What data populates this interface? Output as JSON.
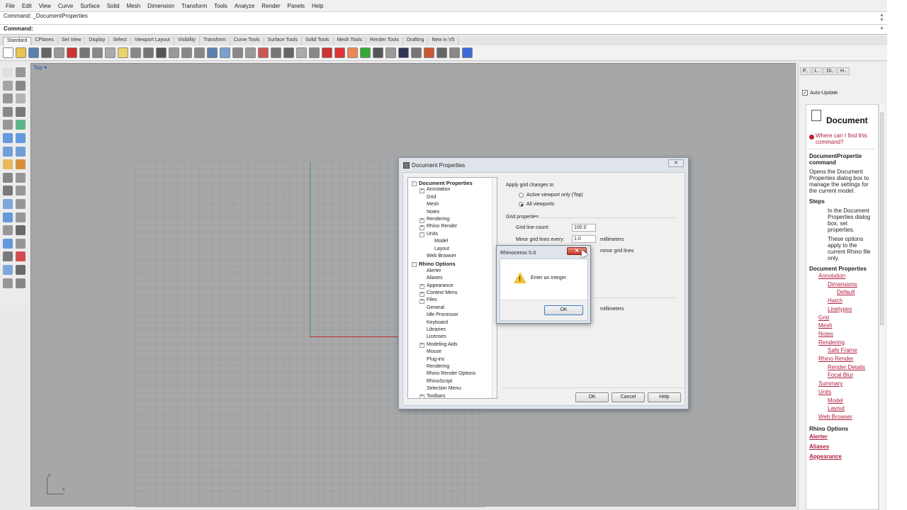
{
  "menu": [
    "File",
    "Edit",
    "View",
    "Curve",
    "Surface",
    "Solid",
    "Mesh",
    "Dimension",
    "Transform",
    "Tools",
    "Analyze",
    "Render",
    "Panels",
    "Help"
  ],
  "command": {
    "history": "Command: _DocumentProperties",
    "prompt": "Command:"
  },
  "toolbar_tabs": [
    "Standard",
    "CPlanes",
    "Set View",
    "Display",
    "Select",
    "Viewport Layout",
    "Visibility",
    "Transform",
    "Curve Tools",
    "Surface Tools",
    "Solid Tools",
    "Mesh Tools",
    "Render Tools",
    "Drafting",
    "New in V5"
  ],
  "viewport": {
    "label": "Top",
    "axis_x": "x",
    "axis_y": "y"
  },
  "right_panel": {
    "tabs": [
      "P..",
      "L..",
      "Di..",
      "H.."
    ],
    "auto_update": "Auto-Update",
    "help": {
      "title": "Document",
      "where_link": "Where can I find this command?",
      "command_name": "DocumentPropertie command",
      "description": "Opens the Document Properties dialog box to manage the settings for the current model.",
      "steps_heading": "Steps",
      "step1": "In the Document Properties dialog box, set properties.",
      "step2": "These options apply to the current Rhino file only.",
      "doc_props_heading": "Document Properties",
      "links": [
        {
          "text": "Annotation",
          "indent": 1
        },
        {
          "text": "Dimensions",
          "indent": 2
        },
        {
          "text": "Default",
          "indent": 3
        },
        {
          "text": "Hatch",
          "indent": 2
        },
        {
          "text": "Linetypes",
          "indent": 2
        },
        {
          "text": "Grid",
          "indent": 1
        },
        {
          "text": "Mesh",
          "indent": 1
        },
        {
          "text": "Notes",
          "indent": 1
        },
        {
          "text": "Rendering",
          "indent": 1
        },
        {
          "text": "Safe Frame",
          "indent": 2
        },
        {
          "text": "Rhino Render",
          "indent": 1
        },
        {
          "text": "Render Details",
          "indent": 2
        },
        {
          "text": "Focal Blur",
          "indent": 2
        },
        {
          "text": "Summary",
          "indent": 1
        },
        {
          "text": "Units",
          "indent": 1
        },
        {
          "text": "Model",
          "indent": 2
        },
        {
          "text": "Layout",
          "indent": 2
        },
        {
          "text": "Web Browser",
          "indent": 1
        }
      ],
      "rhino_options_heading": "Rhino Options",
      "options_links": [
        "Alerter",
        "Aliases",
        "Appearance"
      ]
    }
  },
  "doc_dialog": {
    "title": "Document Properties",
    "close": "✕",
    "tree": [
      {
        "text": "Document Properties",
        "level": 0,
        "bold": true,
        "exp": "-"
      },
      {
        "text": "Annotation",
        "level": 1,
        "exp": "+"
      },
      {
        "text": "Grid",
        "level": 1
      },
      {
        "text": "Mesh",
        "level": 1
      },
      {
        "text": "Notes",
        "level": 1
      },
      {
        "text": "Rendering",
        "level": 1,
        "exp": "+"
      },
      {
        "text": "Rhino Render",
        "level": 1,
        "exp": "+"
      },
      {
        "text": "Units",
        "level": 1,
        "exp": "-"
      },
      {
        "text": "Model",
        "level": 2
      },
      {
        "text": "Layout",
        "level": 2
      },
      {
        "text": "Web Browser",
        "level": 1
      },
      {
        "text": "Rhino Options",
        "level": 0,
        "bold": true,
        "exp": "-"
      },
      {
        "text": "Alerter",
        "level": 1
      },
      {
        "text": "Aliases",
        "level": 1
      },
      {
        "text": "Appearance",
        "level": 1,
        "exp": "+"
      },
      {
        "text": "Context Menu",
        "level": 1,
        "exp": "+"
      },
      {
        "text": "Files",
        "level": 1,
        "exp": "+"
      },
      {
        "text": "General",
        "level": 1
      },
      {
        "text": "Idle Processor",
        "level": 1
      },
      {
        "text": "Keyboard",
        "level": 1
      },
      {
        "text": "Libraries",
        "level": 1
      },
      {
        "text": "Licenses",
        "level": 1
      },
      {
        "text": "Modeling Aids",
        "level": 1,
        "exp": "+"
      },
      {
        "text": "Mouse",
        "level": 1
      },
      {
        "text": "Plug-ins",
        "level": 1
      },
      {
        "text": "Rendering",
        "level": 1
      },
      {
        "text": "Rhino Render Options",
        "level": 1
      },
      {
        "text": "RhinoScript",
        "level": 1
      },
      {
        "text": "Selection Menu",
        "level": 1
      },
      {
        "text": "Toolbars",
        "level": 1,
        "exp": "+"
      }
    ],
    "apply_label": "Apply grid changes to",
    "radio_active": "Active viewport only (Top)",
    "radio_all": "All viewports",
    "grid_props_label": "Grid properties",
    "grid_line_count_label": "Grid line count:",
    "grid_line_count_value": "100.0",
    "minor_label": "Minor grid lines every:",
    "minor_value": "1.0",
    "unit1": "millimeters",
    "unit2": "minor grid lines",
    "unit3": "millimeters",
    "ok": "OK",
    "cancel": "Cancel",
    "help": "Help"
  },
  "alert": {
    "title": "Rhinoceros 5.0",
    "close": "✕",
    "icon": "warning-icon",
    "message": "Enter an integer.",
    "ok": "OK"
  }
}
